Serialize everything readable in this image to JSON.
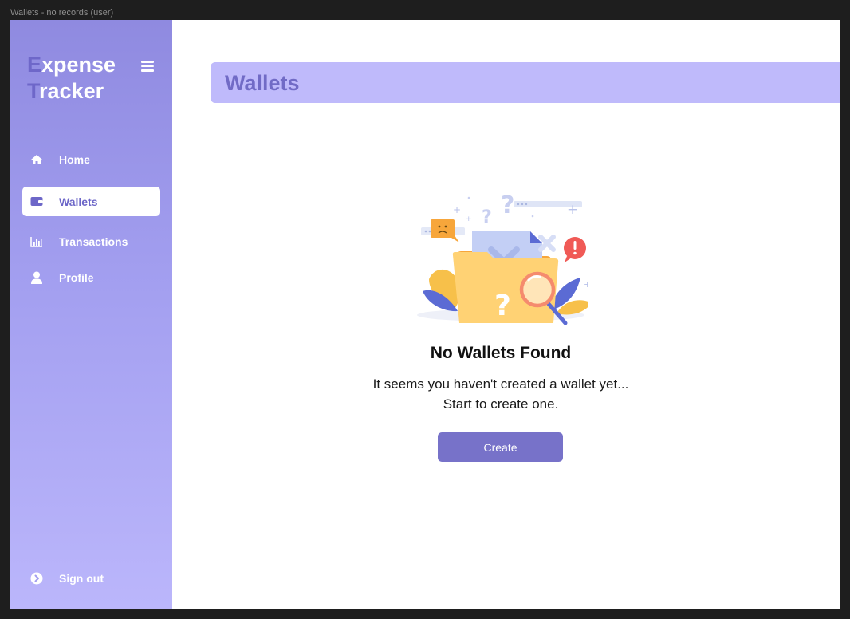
{
  "window": {
    "title": "Wallets - no records (user)"
  },
  "sidebar": {
    "logo": {
      "line1_initial": "E",
      "line1_rest": "xpense",
      "line2_initial": "T",
      "line2_rest": "racker"
    },
    "menu_icon": "hamburger-icon",
    "items": [
      {
        "label": "Home",
        "icon": "home-icon",
        "active": false
      },
      {
        "label": "Wallets",
        "icon": "wallet-icon",
        "active": true
      },
      {
        "label": "Transactions",
        "icon": "bar-chart-icon",
        "active": false
      },
      {
        "label": "Profile",
        "icon": "user-icon",
        "active": false
      }
    ],
    "signout": {
      "label": "Sign out",
      "icon": "chevron-right-circle-icon"
    }
  },
  "main": {
    "header_title": "Wallets",
    "empty_state": {
      "title": "No Wallets Found",
      "message_line1": "It seems you haven't created a wallet yet...",
      "message_line2": "Start to create one.",
      "button_label": "Create"
    }
  },
  "colors": {
    "accent": "#7772c9",
    "header_bg": "#bfbafb",
    "header_text": "#716bc6",
    "sidebar_top": "#8f8ae0",
    "sidebar_bottom": "#bbb6fb"
  }
}
